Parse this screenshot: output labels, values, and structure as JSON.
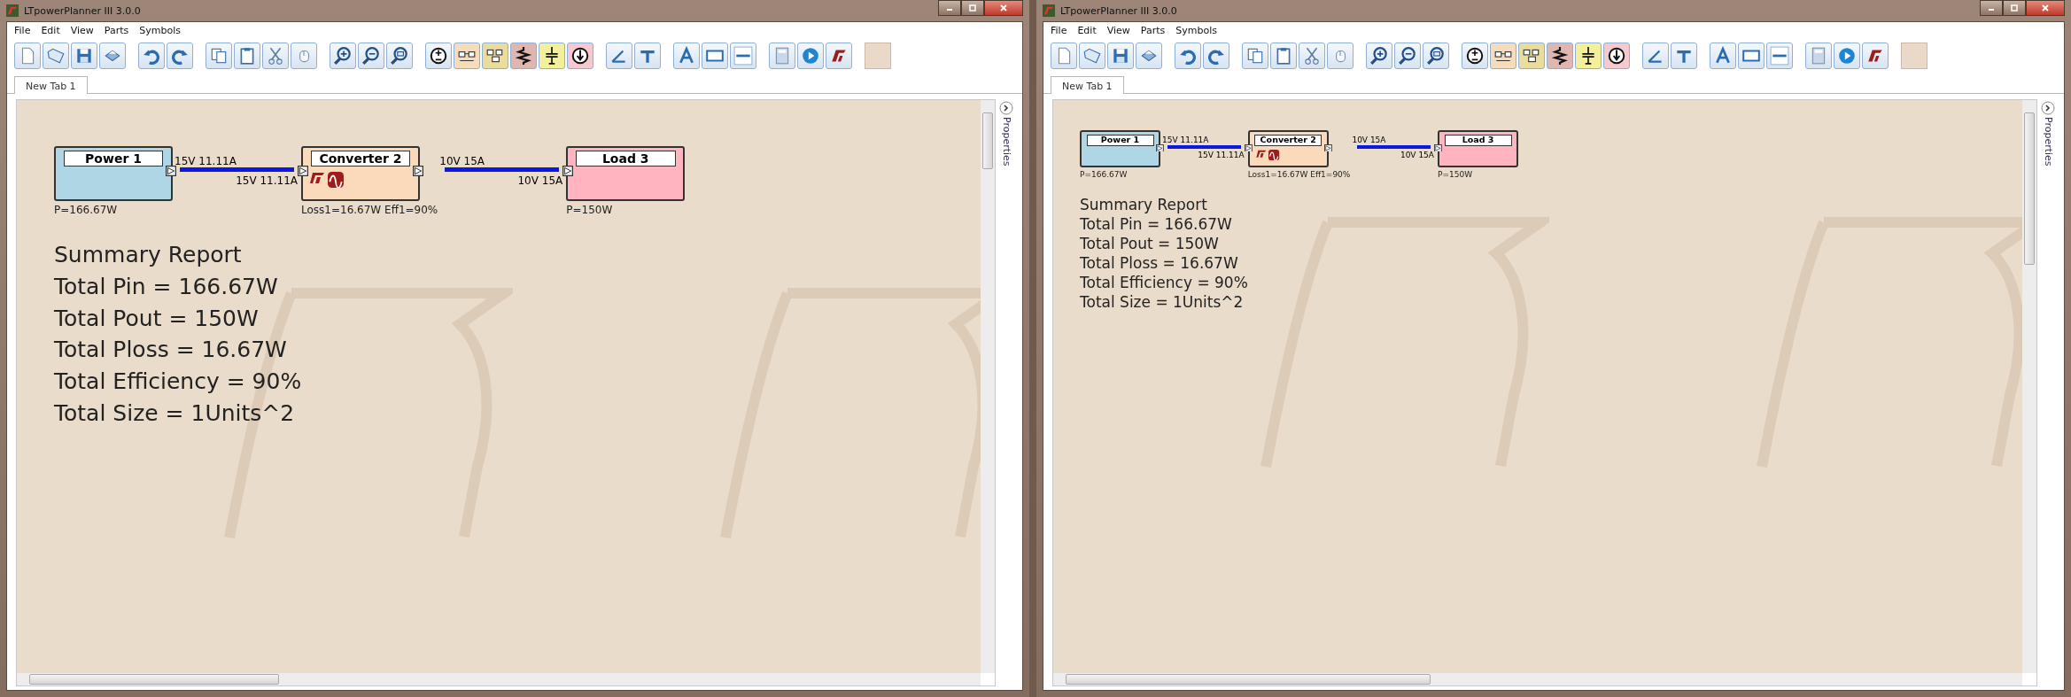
{
  "windows": [
    {
      "title": "LTpowerPlanner III 3.0.0",
      "menu": [
        "File",
        "Edit",
        "View",
        "Parts",
        "Symbols"
      ],
      "tabs": [
        {
          "label": "New Tab 1",
          "selected": true
        }
      ],
      "side_panel": {
        "label": "Properties"
      },
      "diagram": {
        "blocks": [
          {
            "kind": "source",
            "title": "Power 1",
            "caption": "P=166.67W"
          },
          {
            "kind": "converter",
            "title": "Converter 2",
            "caption": "Loss1=16.67W Eff1=90%"
          },
          {
            "kind": "load",
            "title": "Load 3",
            "caption": "P=150W"
          }
        ],
        "connections": [
          {
            "out_label": "15V 11.11A",
            "in_label": "15V 11.11A"
          },
          {
            "out_label": "10V 15A",
            "in_label": "10V 15A"
          }
        ]
      },
      "summary": [
        "Summary Report",
        "Total Pin = 166.67W",
        "Total Pout = 150W",
        "Total Ploss = 16.67W",
        "Total Efficiency = 90%",
        "Total Size = 1Units^2"
      ]
    },
    {
      "title": "LTpowerPlanner III 3.0.0",
      "menu": [
        "File",
        "Edit",
        "View",
        "Parts",
        "Symbols"
      ],
      "tabs": [
        {
          "label": "New Tab 1",
          "selected": true
        }
      ],
      "side_panel": {
        "label": "Properties"
      },
      "diagram": {
        "blocks": [
          {
            "kind": "source",
            "title": "Power 1",
            "caption": "P=166.67W"
          },
          {
            "kind": "converter",
            "title": "Converter 2",
            "caption": "Loss1=16.67W Eff1=90%"
          },
          {
            "kind": "load",
            "title": "Load 3",
            "caption": "P=150W"
          }
        ],
        "connections": [
          {
            "out_label": "15V 11.11A",
            "in_label": "15V 11.11A"
          },
          {
            "out_label": "10V 15A",
            "in_label": "10V 15A"
          }
        ]
      },
      "summary": [
        "Summary Report",
        "Total Pin = 166.67W",
        "Total Pout = 150W",
        "Total Ploss = 16.67W",
        "Total Efficiency = 90%",
        "Total Size = 1Units^2"
      ]
    }
  ]
}
